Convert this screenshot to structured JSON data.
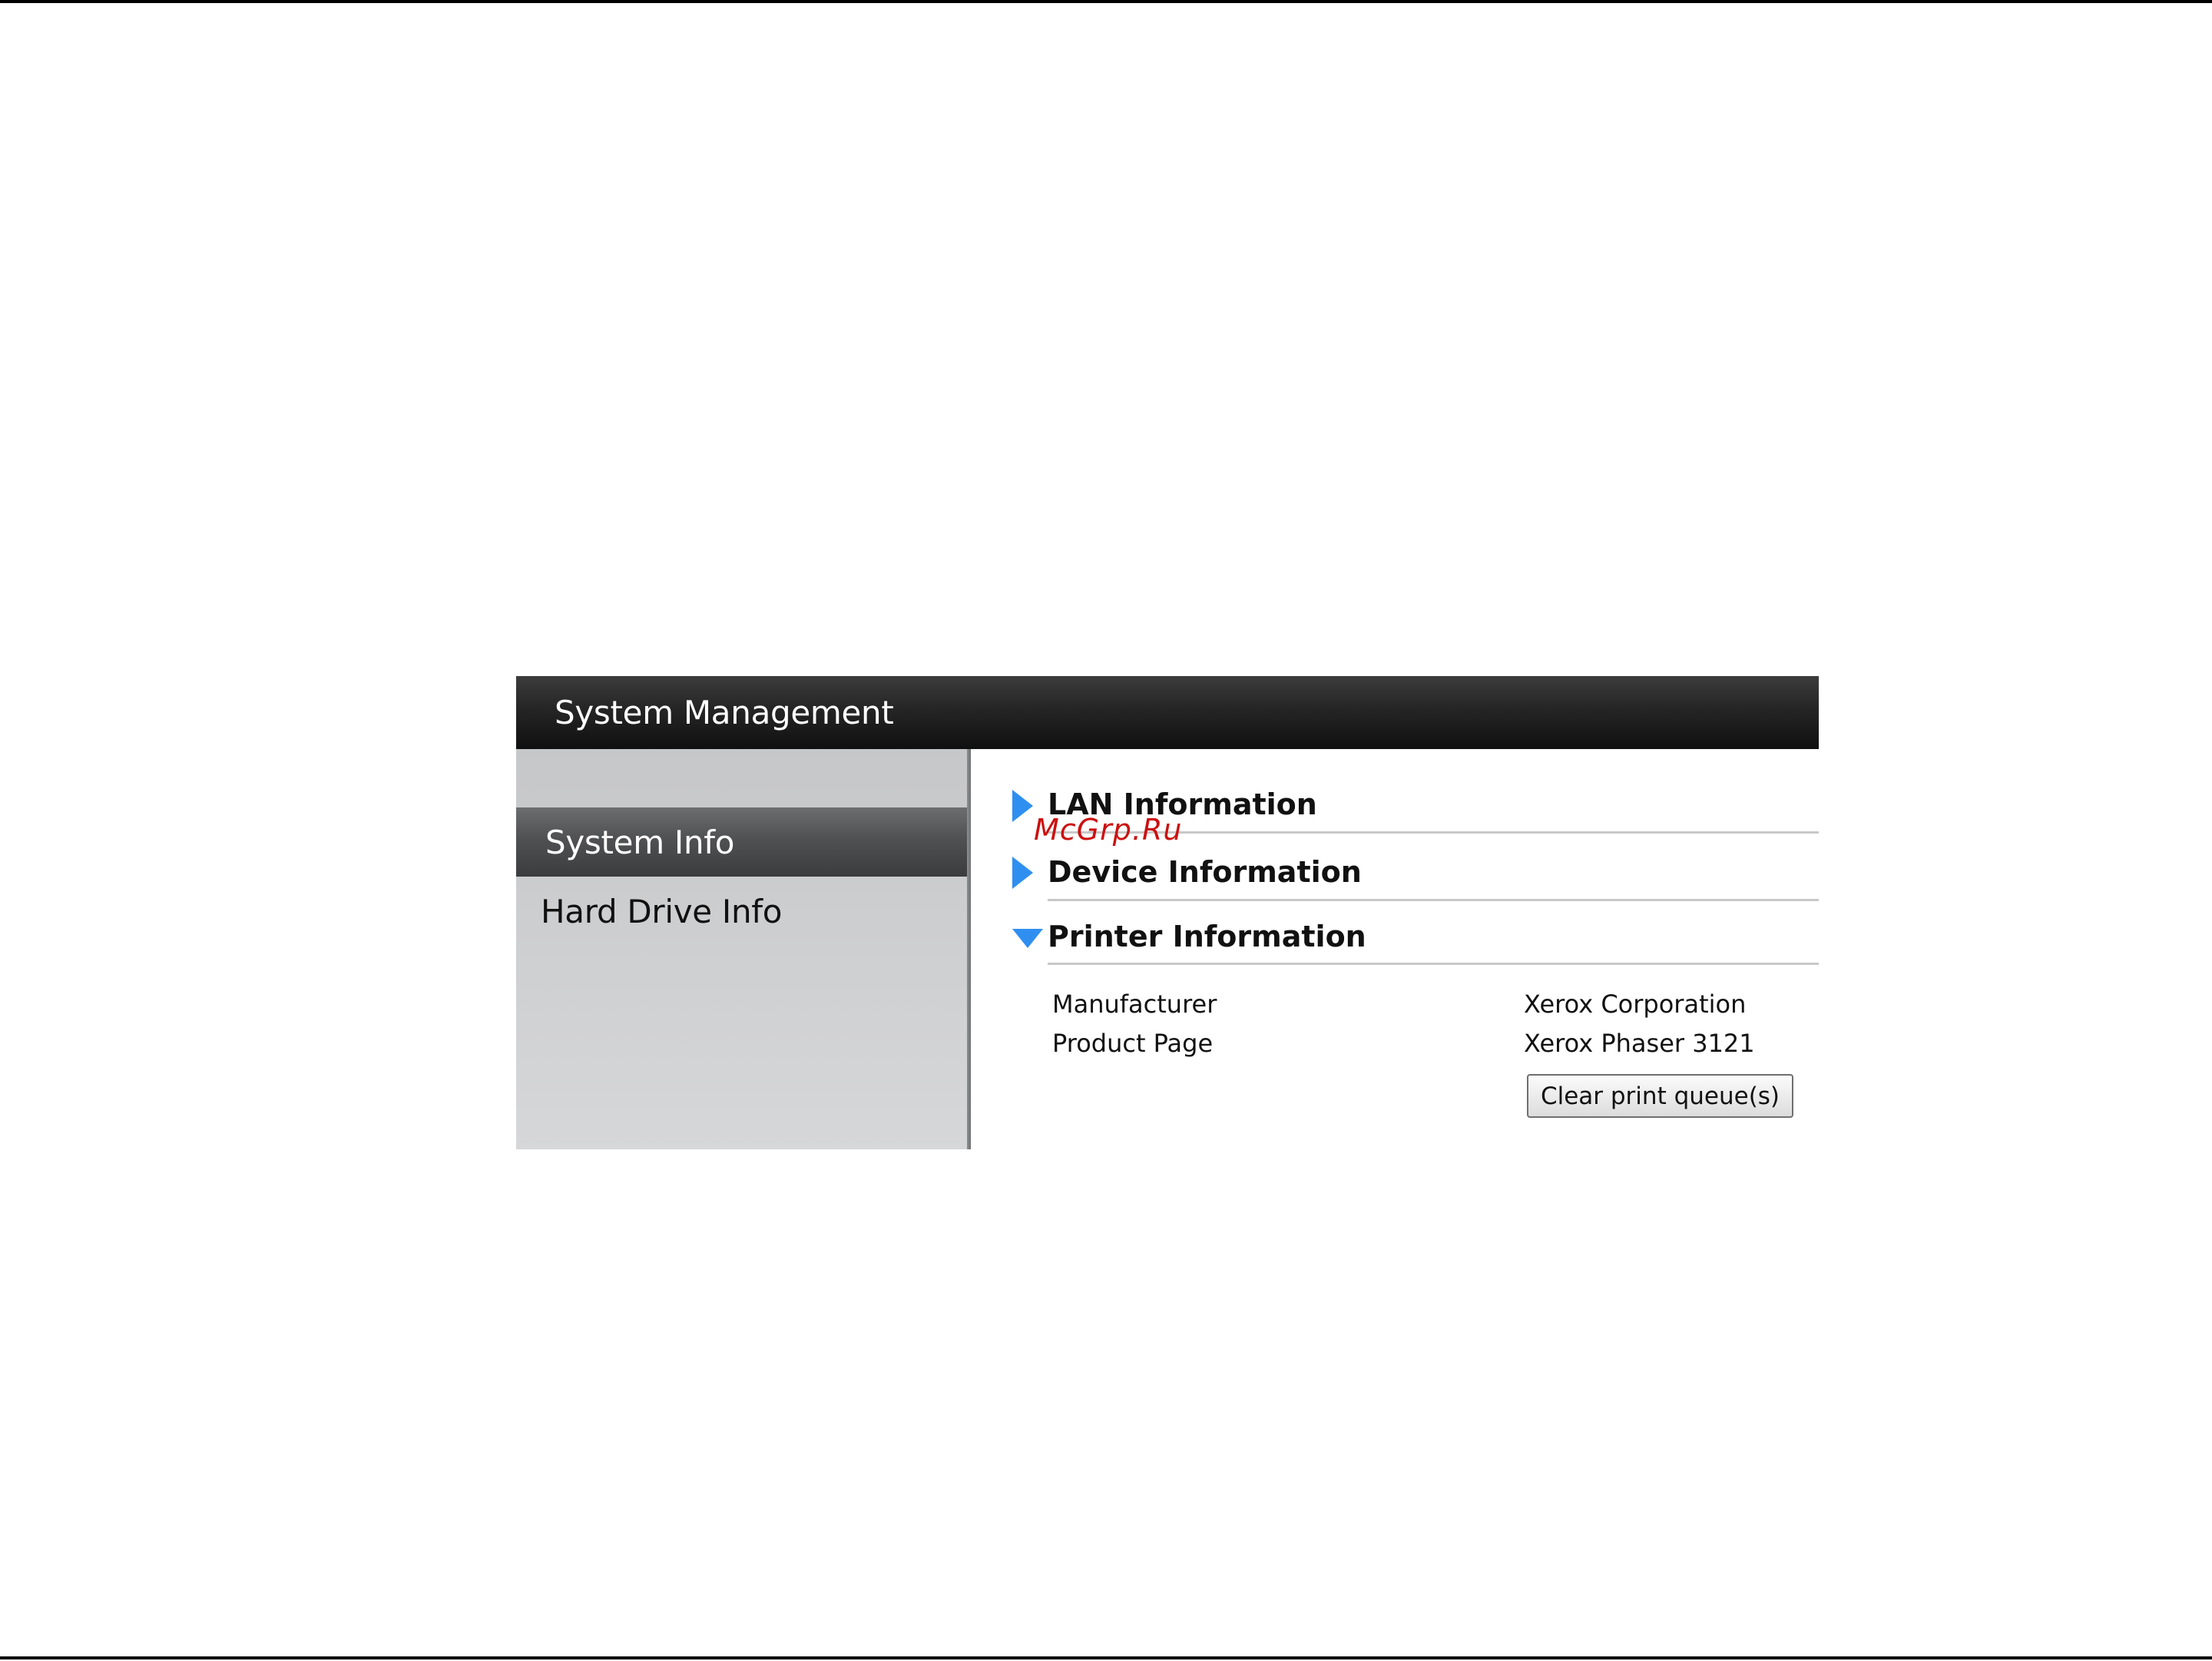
{
  "window": {
    "title": "System Management"
  },
  "sidebar": {
    "items": [
      {
        "label": "System Info",
        "active": true
      },
      {
        "label": "Hard Drive Info",
        "active": false
      }
    ]
  },
  "sections": [
    {
      "label": "LAN Information",
      "expanded": false,
      "icon": "triangle-right-icon"
    },
    {
      "label": "Device Information",
      "expanded": false,
      "icon": "triangle-right-icon"
    },
    {
      "label": "Printer Information",
      "expanded": true,
      "icon": "triangle-down-icon"
    }
  ],
  "printer_info": {
    "rows": [
      {
        "label": "Manufacturer",
        "value": "Xerox Corporation"
      },
      {
        "label": "Product Page",
        "value": "Xerox Phaser 3121"
      }
    ],
    "clear_button_label": "Clear print queue(s)"
  },
  "watermark": "McGrp.Ru",
  "colors": {
    "accent_arrow": "#2f8ff0",
    "title_bar": "#1a1a1a",
    "sidebar_bg": "#cfd0d2",
    "sidebar_active": "#4a4b4d",
    "watermark": "#cc1010"
  }
}
